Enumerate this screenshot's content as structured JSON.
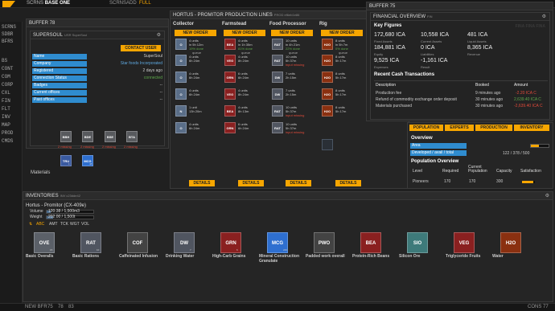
{
  "topbar": {
    "screens_label": "SCRNS",
    "screen_name": "BASE ONE",
    "tabs": [
      "SCRNS",
      "ADD",
      "FULL"
    ]
  },
  "sidebar": {
    "items": [
      "SCRNS",
      "SDBR",
      "BFRS",
      "BS",
      "CONT",
      "COM",
      "CORP",
      "CXL",
      "FIN",
      "FLT",
      "INV",
      "MAP",
      "PROD",
      "CMDS"
    ]
  },
  "bottombar": {
    "new_bfr": "NEW BFR",
    "nums": [
      "75",
      "78",
      "83"
    ],
    "cons": "CONS 77"
  },
  "accent": "#f7a600",
  "buf78": {
    "title": "BUFFER 78",
    "panel_title": "SUPERSOUL",
    "panel_sub": "USR SuperSoul",
    "contact_btn": "CONTACT USER",
    "rows": [
      {
        "label": "Name",
        "value": "SuperSoul"
      },
      {
        "label": "Company",
        "value": "Star foods Incorporated"
      },
      {
        "label": "Registered",
        "value": "2 days ago"
      },
      {
        "label": "Connection Status",
        "value": "connected"
      },
      {
        "label": "Badges",
        "value": "--"
      },
      {
        "label": "Current offices",
        "value": "--"
      },
      {
        "label": "Past offices",
        "value": "--"
      }
    ]
  },
  "materials": {
    "label": "Materials",
    "items": [
      {
        "ticker": "BBH",
        "missing": "2 missing",
        "color": "#585a5e"
      },
      {
        "ticker": "BDE",
        "missing": "2 missing",
        "color": "#585a5e"
      },
      {
        "ticker": "BSE",
        "missing": "2 missing",
        "color": "#585a5e"
      },
      {
        "ticker": "BTA",
        "missing": "2 missing",
        "color": "#585a5e"
      }
    ],
    "row2": [
      {
        "ticker": "TRU",
        "count": "1",
        "color": "#3a5aa0"
      },
      {
        "ticker": "MCG",
        "count": "48",
        "color": "#2e6fd0"
      }
    ]
  },
  "prod": {
    "title": "HORTUS - PROMITOR PRODUCTION LINES",
    "sub": "PROD ef6eb1e86",
    "new_order": "NEW ORDER",
    "details": "DETAILS",
    "queue": "queue",
    "columns": [
      {
        "name": "Collector",
        "jobs": [
          {
            "t": "O",
            "c": "#5a6e88",
            "l1": "4 units",
            "l2": "in 5h 12m",
            "l3": "19% done",
            "s": "green"
          },
          {
            "t": "O",
            "c": "#5a6e88",
            "l1": "4 units",
            "l2": "6h 24m",
            "l3": "",
            "s": ""
          },
          {
            "t": "O",
            "c": "#5a6e88",
            "l1": "4 units",
            "l2": "6h 24m",
            "l3": "",
            "s": ""
          },
          {
            "t": "O",
            "c": "#5a6e88",
            "l1": "4 units",
            "l2": "6h 24m",
            "l3": "",
            "s": ""
          },
          {
            "t": "N",
            "c": "#5a6e88",
            "l1": "1 unit",
            "l2": "13h 20m",
            "l3": "",
            "s": ""
          },
          {
            "t": "O",
            "c": "#5a6e88",
            "l1": "4 units",
            "l2": "6h 24m",
            "l3": "",
            "s": ""
          }
        ]
      },
      {
        "name": "Farmstead",
        "jobs": [
          {
            "t": "BEA",
            "c": "#8a2020",
            "l1": "4 units",
            "l2": "in 1h 35m",
            "l3": "81% done",
            "s": "green"
          },
          {
            "t": "VEG",
            "c": "#8a2020",
            "l1": "4 units",
            "l2": "8h 24m",
            "l3": "",
            "s": ""
          },
          {
            "t": "GRN",
            "c": "#8a2020",
            "l1": "6 units",
            "l2": "6h 24m",
            "l3": "",
            "s": ""
          },
          {
            "t": "VEG",
            "c": "#8a2020",
            "l1": "4 units",
            "l2": "8h 24m",
            "l3": "",
            "s": ""
          },
          {
            "t": "BEA",
            "c": "#8a2020",
            "l1": "4 units",
            "l2": "8h 13m",
            "l3": "",
            "s": ""
          },
          {
            "t": "GRN",
            "c": "#8a2020",
            "l1": "6 units",
            "l2": "6h 24m",
            "l3": "",
            "s": ""
          }
        ]
      },
      {
        "name": "Food Processor",
        "jobs": [
          {
            "t": "RAT",
            "c": "#505560",
            "l1": "10 units",
            "l2": "in 4h 21m",
            "l3": "22% done",
            "s": "green"
          },
          {
            "t": "RAT",
            "c": "#505560",
            "l1": "10 units",
            "l2": "5h 37m",
            "l3": "input missing",
            "s": "red"
          },
          {
            "t": "DW",
            "c": "#505560",
            "l1": "7 units",
            "l2": "2h 15m",
            "l3": "",
            "s": ""
          },
          {
            "t": "DW",
            "c": "#505560",
            "l1": "7 units",
            "l2": "2h 15m",
            "l3": "",
            "s": ""
          },
          {
            "t": "RAT",
            "c": "#505560",
            "l1": "10 units",
            "l2": "5h 37m",
            "l3": "input missing",
            "s": "red"
          },
          {
            "t": "RAT",
            "c": "#505560",
            "l1": "10 units",
            "l2": "5h 37m",
            "l3": "input missing",
            "s": "red"
          }
        ]
      },
      {
        "name": "Rig",
        "jobs": [
          {
            "t": "H2O",
            "c": "#8a3010",
            "l1": "8 units",
            "l2": "in 5h 7m",
            "l3": "0% done",
            "s": "green"
          },
          {
            "t": "H2O",
            "c": "#8a3010",
            "l1": "8 units",
            "l2": "5h 17m",
            "l3": "",
            "s": ""
          },
          {
            "t": "H2O",
            "c": "#8a3010",
            "l1": "8 units",
            "l2": "5h 17m",
            "l3": "",
            "s": ""
          },
          {
            "t": "H2O",
            "c": "#8a3010",
            "l1": "8 units",
            "l2": "5h 17m",
            "l3": "",
            "s": ""
          },
          {
            "t": "H2O",
            "c": "#8a3010",
            "l1": "8 units",
            "l2": "5h 17m",
            "l3": "",
            "s": ""
          }
        ]
      }
    ]
  },
  "buf75": {
    "title": "BUFFER 75",
    "panel_title": "FINANCIAL OVERVIEW",
    "panel_sub": "FIN",
    "watermark": "FINA FINA FINA",
    "key_figures": "Key Figures",
    "figs": [
      {
        "v": "172,680 ICA",
        "l": "Fixed Assets"
      },
      {
        "v": "10,558 ICA",
        "l": "Current Assets"
      },
      {
        "v": "481 ICA",
        "l": "Liquid Assets"
      },
      {
        "v": "184,881 ICA",
        "l": "Equity"
      },
      {
        "v": "0 ICA",
        "l": "Liabilities"
      },
      {
        "v": "8,365 ICA",
        "l": "Revenue"
      },
      {
        "v": "9,525 ICA",
        "l": "Expenses"
      },
      {
        "v": "-1,161 ICA",
        "l": "Result"
      }
    ],
    "recent": "Recent Cash Transactions",
    "tx_headers": [
      "Description",
      "Booked",
      "Amount"
    ],
    "tx": [
      {
        "d": "Production fee",
        "b": "9 minutes ago",
        "a": "-2.20 ICA C"
      },
      {
        "d": "Refund of commodity exchange order deposit",
        "b": "30 minutes ago",
        "a": "2,639.40 ICA C"
      },
      {
        "d": "Materials purchased",
        "b": "30 minutes ago",
        "a": "-2,639.40 ICA C"
      }
    ]
  },
  "base": {
    "tabs": [
      "POPULATION",
      "EXPERTS",
      "PRODUCTION",
      "INVENTORY"
    ],
    "overview": "Overview",
    "area_label": "Area",
    "area_fill_pct": 45,
    "dev_label": "Developed / avail / total",
    "dev_value": "122 / 378 / 500",
    "pop_title": "Population Overview",
    "pop_headers": [
      "Level",
      "Required",
      "Current Population",
      "Capacity",
      "Satisfaction"
    ],
    "pop_row": {
      "level": "Pioneers",
      "required": "170",
      "current": "170",
      "capacity": "300",
      "satisfaction_pct": 90
    }
  },
  "inv": {
    "title": "INVENTORIES",
    "sub": "INV c23dde42",
    "site": "Hortus - Promitor (CX-409e)",
    "volume_label": "Volume",
    "volume_value": "120.38 / 1,500m3",
    "volume_fill_pct": 8,
    "weight_label": "Weight",
    "weight_value": "202.00 / 1,500t",
    "weight_fill_pct": 13,
    "sort_tabs": [
      "ABC",
      "AMT",
      "TCK",
      "WGT",
      "VOL"
    ],
    "items": [
      {
        "t": "OVE",
        "c": "#5b6068",
        "n": "15",
        "name": "Basic Overalls"
      },
      {
        "t": "RAT",
        "c": "#505560",
        "n": "10",
        "name": "Basic Rations"
      },
      {
        "t": "COF",
        "c": "#434343",
        "n": "",
        "name": "Caffeinated Infusion"
      },
      {
        "t": "DW",
        "c": "#505560",
        "n": "7",
        "name": "Drinking Water"
      },
      {
        "t": "GRN",
        "c": "#8a2020",
        "n": "6",
        "name": "High-Carb Grains"
      },
      {
        "t": "MCG",
        "c": "#2e6fd0",
        "n": "240",
        "name": "Mineral Construction Granulate"
      },
      {
        "t": "PWO",
        "c": "#434343",
        "n": "",
        "name": "Padded work overall"
      },
      {
        "t": "BEA",
        "c": "#8a2020",
        "n": "",
        "name": "Protein-Rich Beans"
      },
      {
        "t": "SIO",
        "c": "#3e7a7a",
        "n": "",
        "name": "Silicon Ore"
      },
      {
        "t": "VEG",
        "c": "#8a2020",
        "n": "",
        "name": "Triglyceride Fruits"
      },
      {
        "t": "H2O",
        "c": "#8a3010",
        "n": "",
        "name": "Water"
      }
    ]
  }
}
